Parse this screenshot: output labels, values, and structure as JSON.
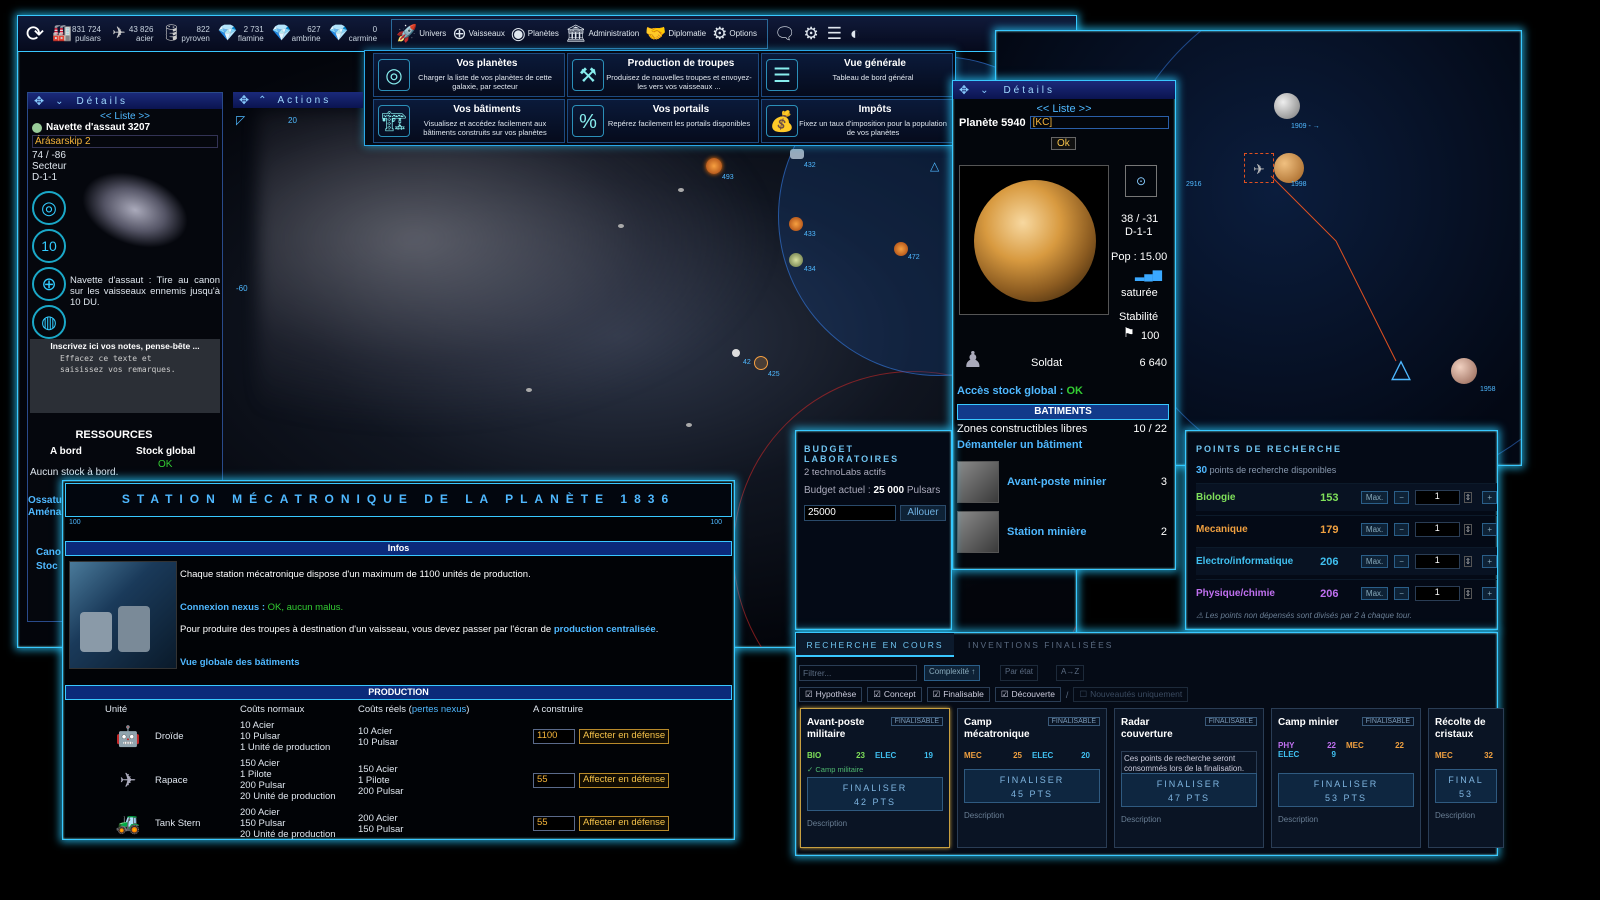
{
  "topbar": {
    "resources": [
      {
        "icon": "factory-icon",
        "glyph": "🏭",
        "amount": "831 724",
        "name": "pulsars"
      },
      {
        "icon": "fighter-icon",
        "glyph": "✈",
        "amount": "43 826",
        "name": "acier"
      },
      {
        "icon": "barrel-icon",
        "glyph": "🛢",
        "amount": "822",
        "name": "pyroven"
      },
      {
        "icon": "crystal-yellow-icon",
        "glyph": "💎",
        "amount": "2 731",
        "name": "flamine"
      },
      {
        "icon": "crystal-amber-icon",
        "glyph": "💎",
        "amount": "627",
        "name": "ambrine"
      },
      {
        "icon": "crystal-red-icon",
        "glyph": "💎",
        "amount": "0",
        "name": "carmine"
      }
    ],
    "nav": [
      {
        "label": "Univers",
        "glyph": "🚀"
      },
      {
        "label": "Vaisseaux",
        "glyph": "⊕"
      },
      {
        "label": "Planètes",
        "glyph": "◉"
      },
      {
        "label": "Administration",
        "glyph": "🏛"
      },
      {
        "label": "Diplomatie",
        "glyph": "🤝"
      },
      {
        "label": "Options",
        "glyph": "⚙"
      }
    ]
  },
  "menu": [
    {
      "title": "Vos planètes",
      "desc": "Charger la liste de vos planètes de cette galaxie, par secteur",
      "glyph": "◎"
    },
    {
      "title": "Production de troupes",
      "desc": "Produisez de nouvelles troupes et envoyez-les vers vos vaisseaux ...",
      "glyph": "⚒"
    },
    {
      "title": "Vue générale",
      "desc": "Tableau de bord général",
      "glyph": "☰"
    },
    {
      "title": "Vos bâtiments",
      "desc": "Visualisez et accédez facilement aux bâtiments construits sur vos planètes",
      "glyph": "🏗"
    },
    {
      "title": "Vos portails",
      "desc": "Repérez facilement les portails disponibles",
      "glyph": "%"
    },
    {
      "title": "Impôts",
      "desc": "Fixez un taux d'imposition pour la population de vos planètes",
      "glyph": "💰"
    }
  ],
  "left_panel": {
    "header": "Détails",
    "list_label": "<< Liste >>",
    "ship_name": "Navette d'assaut 3207",
    "ship_custom": "Árásarskip 2",
    "coords": "74 / -86",
    "sector_label": "Secteur",
    "sector": "D-1-1",
    "ship_desc": "Navette d'assaut : Tire au canon sur les vaisseaux ennemis jusqu'à 10 DU.",
    "notes_title": "Inscrivez ici vos notes, pense-bête ...",
    "notes_body": "Effacez ce texte et saisissez vos remarques.",
    "res_title": "RESSOURCES",
    "res_col1": "A bord",
    "res_col2": "Stock global",
    "res_status": "OK",
    "res_empty": "Aucun stock à bord.",
    "cut1": "Ossatu",
    "cut2": "Aména",
    "cut3": "Cano",
    "cut4": "Stoc"
  },
  "actions": {
    "label": "Actions",
    "coord": "20"
  },
  "map_labels": {
    "y_axis": "-60"
  },
  "details": {
    "header": "Détails",
    "list_label": "<< Liste >>",
    "planet_name": "Planète 5940",
    "planet_tag": "[KC]",
    "ok_btn": "Ok",
    "coords": "38 / -31",
    "sector": "D-1-1",
    "pop": "Pop : 15.00",
    "pop_state": "saturée",
    "stability_label": "Stabilité",
    "stability": "100",
    "unit_name": "Soldat",
    "unit_count": "6 640",
    "stock_access": "Accès stock global :",
    "stock_ok": "OK",
    "buildings_header": "BATIMENTS",
    "zones_label": "Zones constructibles libres",
    "zones_value": "10 / 22",
    "dismantle": "Démanteler un bâtiment",
    "buildings": [
      {
        "name": "Avant-poste minier",
        "count": "3"
      },
      {
        "name": "Station minière",
        "count": "2"
      }
    ]
  },
  "station": {
    "title": "STATION MÉCATRONIQUE DE LA PLANÈTE 1836",
    "scale_left": "100",
    "scale_right": "100",
    "infos_header": "Infos",
    "text1": "Chaque station mécatronique dispose d'un maximum de 1100 unités de production.",
    "nexus_label": "Connexion nexus :",
    "nexus_status": "OK, aucun malus.",
    "text2": "Pour produire des troupes à destination d'un vaisseau, vous devez passer par l'écran de",
    "text2_link": "production centralisée",
    "overview_link": "Vue globale des bâtiments",
    "prod_header": "PRODUCTION",
    "cols": {
      "unit": "Unité",
      "normal": "Coûts normaux",
      "real": "Coûts réels (",
      "real_link": "pertes nexus",
      "real_end": ")",
      "build": "A construire"
    },
    "rows": [
      {
        "name": "Droïde",
        "normal": [
          "10 Acier",
          "10 Pulsar",
          "1 Unité de production"
        ],
        "real": [
          "10 Acier",
          "10 Pulsar"
        ],
        "qty": "1100",
        "btn": "Affecter en défense",
        "icon": "droid-icon",
        "glyph": "🤖"
      },
      {
        "name": "Rapace",
        "normal": [
          "150 Acier",
          "1 Pilote",
          "200 Pulsar",
          "20 Unité de production"
        ],
        "real": [
          "150 Acier",
          "1 Pilote",
          "200 Pulsar"
        ],
        "qty": "55",
        "btn": "Affecter en défense",
        "icon": "fighter-icon",
        "glyph": "✈"
      },
      {
        "name": "Tank Stern",
        "normal": [
          "200 Acier",
          "150 Pulsar",
          "20 Unité de production"
        ],
        "real": [
          "200 Acier",
          "150 Pulsar"
        ],
        "qty": "55",
        "btn": "Affecter en défense",
        "icon": "tank-icon",
        "glyph": "🚜"
      }
    ]
  },
  "budget": {
    "title": "BUDGET LABORATOIRES",
    "active": "2 technoLabs actifs",
    "budget_label": "Budget actuel :",
    "budget_value": "25 000",
    "budget_unit": "Pulsars",
    "input": "25000",
    "btn": "Allouer"
  },
  "points": {
    "title": "POINTS DE RECHERCHE",
    "avail_num": "30",
    "avail_txt": "points de recherche disponibles",
    "max_label": "Max.",
    "rows": [
      {
        "name": "Biologie",
        "value": "153",
        "color": "#7fe05a",
        "qty": "1"
      },
      {
        "name": "Mecanique",
        "value": "179",
        "color": "#f0a040",
        "qty": "1"
      },
      {
        "name": "Electro/informatique",
        "value": "206",
        "color": "#40c0f0",
        "qty": "1"
      },
      {
        "name": "Physique/chimie",
        "value": "206",
        "color": "#c070f0",
        "qty": "1"
      }
    ],
    "note": "⚠ Les points non dépensés sont divisés par 2 à chaque tour."
  },
  "research": {
    "tab1": "RECHERCHE EN COURS",
    "tab2": "INVENTIONS FINALISÉES",
    "filter_placeholder": "Filtrer...",
    "sort1": "Complexité ↑",
    "sort2": "Par état",
    "sort3": "A→Z",
    "checks": [
      "Hypothèse",
      "Concept",
      "Finalisable",
      "Découverte"
    ],
    "sep": "/",
    "news": "Nouveautés uniquement",
    "desc_label": "Description",
    "cards": [
      {
        "name": "Avant-poste militaire",
        "badge": "FINALISABLE",
        "stats": [
          [
            "BIO",
            "23",
            "#7fe05a"
          ],
          [
            "ELEC",
            "19",
            "#40c0f0"
          ]
        ],
        "req": "✓ Camp militaire",
        "fin1": "FINALISER",
        "fin2": "42 PTS"
      },
      {
        "name": "Camp mécatronique",
        "badge": "FINALISABLE",
        "stats": [
          [
            "MEC",
            "25",
            "#f0a040"
          ],
          [
            "ELEC",
            "20",
            "#40c0f0"
          ]
        ],
        "req": "",
        "fin1": "FINALISER",
        "fin2": "45 PTS"
      },
      {
        "name": "Radar couverture",
        "badge": "FINALISABLE",
        "stats": [],
        "req": "Ces points de recherche seront consommés lors de la finalisation.",
        "fin1": "FINALISER",
        "fin2": "47 PTS"
      },
      {
        "name": "Camp minier",
        "badge": "FINALISABLE",
        "stats": [
          [
            "PHY",
            "22",
            "#c070f0"
          ],
          [
            "MEC",
            "22",
            "#f0a040"
          ],
          [
            "ELEC",
            "9",
            "#40c0f0"
          ]
        ],
        "req": "",
        "fin1": "FINALISER",
        "fin2": "53 PTS"
      },
      {
        "name": "Récolte de cristaux",
        "badge": "",
        "stats": [
          [
            "MEC",
            "32",
            "#f0a040"
          ]
        ],
        "req": "",
        "fin1": "FINAL",
        "fin2": "53"
      }
    ]
  },
  "map_right_labels": [
    "1909 - →",
    "2916",
    "1998",
    "1958"
  ],
  "map_planet_labels": [
    "493",
    "432",
    "433",
    "434",
    "472",
    "425",
    "42"
  ]
}
